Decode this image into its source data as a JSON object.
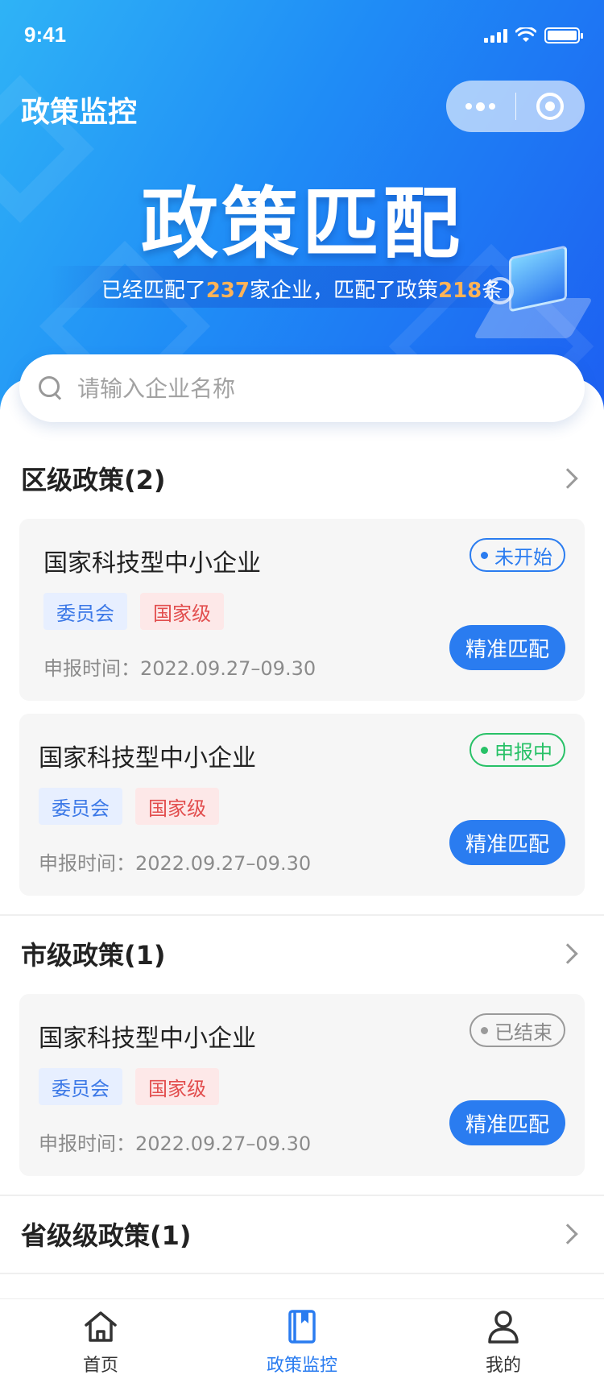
{
  "status_bar": {
    "time": "9:41"
  },
  "header": {
    "app_title": "政策监控",
    "hero_title": "政策匹配",
    "stats": {
      "prefix": "已经匹配了",
      "company_count": "237",
      "mid": "家企业，匹配了政策",
      "policy_count": "218",
      "suffix": "条"
    }
  },
  "search": {
    "placeholder": "请输入企业名称",
    "value": ""
  },
  "sections": [
    {
      "title": "区级政策(2)",
      "cards": [
        {
          "title": "国家科技型中小企业",
          "status": "未开始",
          "tags": [
            "委员会",
            "国家级"
          ],
          "date": "申报时间：2022.09.27–09.30",
          "button": "精准匹配"
        },
        {
          "title": "国家科技型中小企业",
          "status": "申报中",
          "tags": [
            "委员会",
            "国家级"
          ],
          "date": "申报时间：2022.09.27–09.30",
          "button": "精准匹配"
        }
      ]
    },
    {
      "title": "市级政策(1)",
      "cards": [
        {
          "title": "国家科技型中小企业",
          "status": "已结束",
          "tags": [
            "委员会",
            "国家级"
          ],
          "date": "申报时间：2022.09.27–09.30",
          "button": "精准匹配"
        }
      ]
    },
    {
      "title": "省级级政策(1)",
      "cards": []
    }
  ],
  "tabbar": {
    "items": [
      {
        "label": "首页",
        "icon": "home-icon",
        "active": false
      },
      {
        "label": "政策监控",
        "icon": "book-icon",
        "active": true
      },
      {
        "label": "我的",
        "icon": "user-icon",
        "active": false
      }
    ]
  },
  "colors": {
    "primary": "#2a7cf0",
    "highlight": "#ffb357",
    "status_pending": "#2a7cf0",
    "status_active": "#28c167",
    "status_ended": "#9a9a9a",
    "tag_blue": "#3b78e7",
    "tag_red": "#e24e4e"
  }
}
